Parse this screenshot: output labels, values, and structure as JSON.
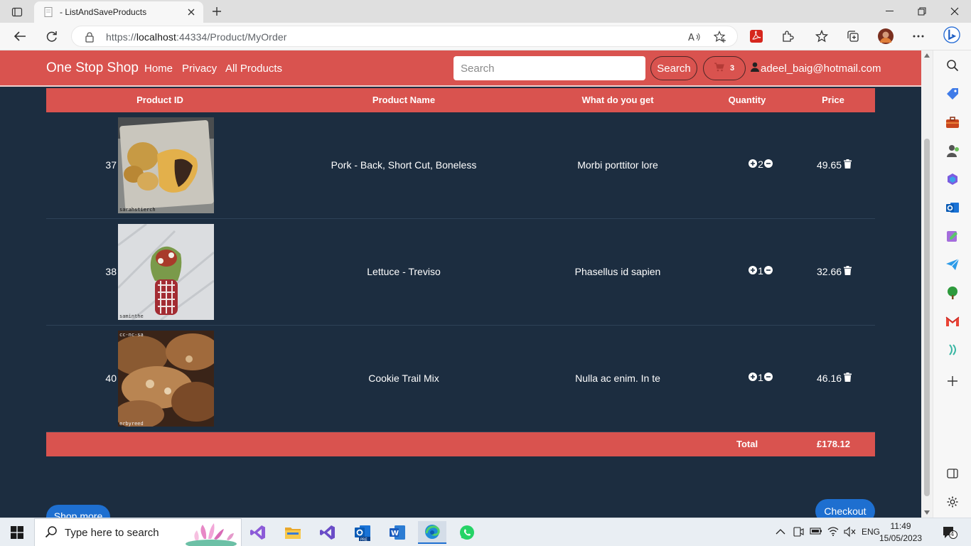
{
  "browser": {
    "tab_title": "- ListAndSaveProducts",
    "url_prefix": "https://",
    "url_host": "localhost",
    "url_rest": ":44334/Product/MyOrder"
  },
  "site": {
    "brand": "One Stop Shop",
    "nav": [
      "Home",
      "Privacy",
      "All Products"
    ],
    "search_placeholder": "Search",
    "search_button": "Search",
    "cart_count": "3",
    "user_email": "adeel_baig@hotmail.com",
    "accent_color": "#d9534f",
    "page_bg": "#1c2d40",
    "button_blue": "#1e6fd0"
  },
  "order": {
    "headers": [
      "Product ID",
      "Product Name",
      "What do you get",
      "Quantity",
      "Price"
    ],
    "rows": [
      {
        "id": "37",
        "name": "Pork - Back, Short Cut, Boneless",
        "desc": "Morbi porttitor lore",
        "qty": "2",
        "price": "49.65",
        "image_caption": "sarahstierch"
      },
      {
        "id": "38",
        "name": "Lettuce - Treviso",
        "desc": "Phasellus id sapien",
        "qty": "1",
        "price": "32.66",
        "image_caption": "saminthe"
      },
      {
        "id": "40",
        "name": "Cookie Trail Mix",
        "desc": "Nulla ac enim. In te",
        "qty": "1",
        "price": "46.16",
        "image_caption": "erbyreed"
      }
    ],
    "total_label": "Total",
    "total_value": "£178.12",
    "shop_more": "Shop more",
    "checkout": "Checkout"
  },
  "taskbar": {
    "search_text": "Type here to search",
    "language": "ENG",
    "time": "11:49",
    "date": "15/05/2023",
    "notifications": "4"
  }
}
